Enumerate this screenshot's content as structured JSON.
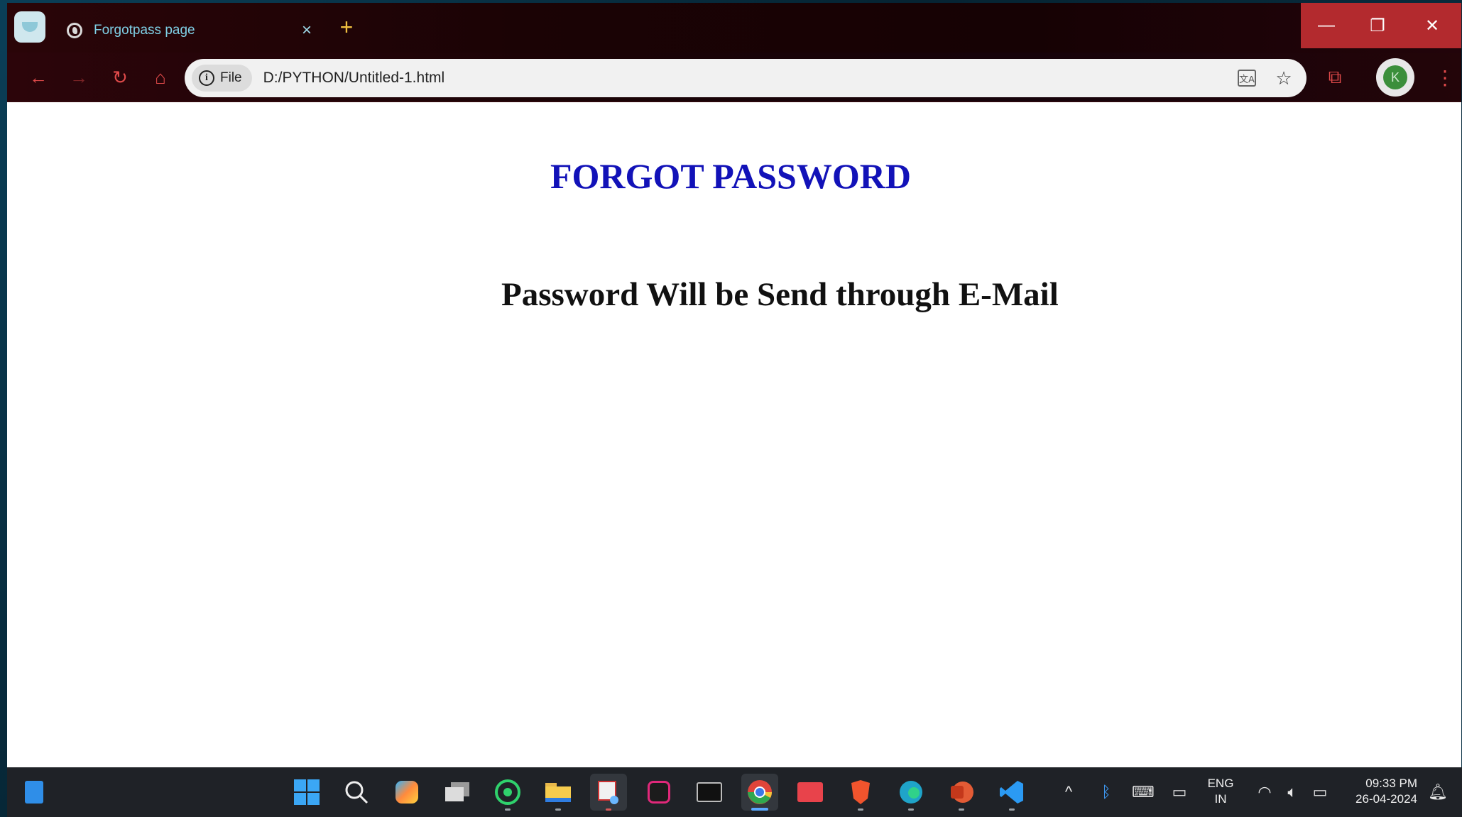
{
  "browser": {
    "tab_title": "Forgotpass page",
    "tab_close_glyph": "×",
    "new_tab_glyph": "+",
    "window_controls": {
      "minimize": "—",
      "restore": "❐",
      "close": "✕"
    },
    "nav": {
      "back": "←",
      "forward": "→",
      "reload": "↻",
      "home": "⌂"
    },
    "address_bar": {
      "scheme_chip": "File",
      "info_glyph": "i",
      "url": "D:/PYTHON/Untitled-1.html"
    },
    "omnibox_icons": {
      "translate": "文A",
      "bookmark": "☆"
    },
    "extensions_glyph": "⧉",
    "avatar_letter": "K",
    "menu_glyph": "⋮"
  },
  "page": {
    "heading": "FORGOT PASSWORD",
    "message": "Password Will be Send through E-Mail"
  },
  "taskbar": {
    "apps": [
      "file-explorer-widget",
      "start",
      "search",
      "copilot",
      "task-view",
      "whatsapp",
      "file-explorer",
      "snipping-tool",
      "pen-app",
      "terminal",
      "chrome",
      "news",
      "brave",
      "edge",
      "powerpoint",
      "vscode"
    ],
    "tray": {
      "chevron": "^",
      "language_line1": "ENG",
      "language_line2": "IN",
      "time": "09:33 PM",
      "date": "26-04-2024"
    }
  },
  "colors": {
    "heading": "#1212b8",
    "message": "#111111",
    "titlebar": "#1b0305",
    "window_controls": "#b32a2e",
    "accent_icons": "#e04a4a",
    "tab_title": "#7fd0e6"
  }
}
